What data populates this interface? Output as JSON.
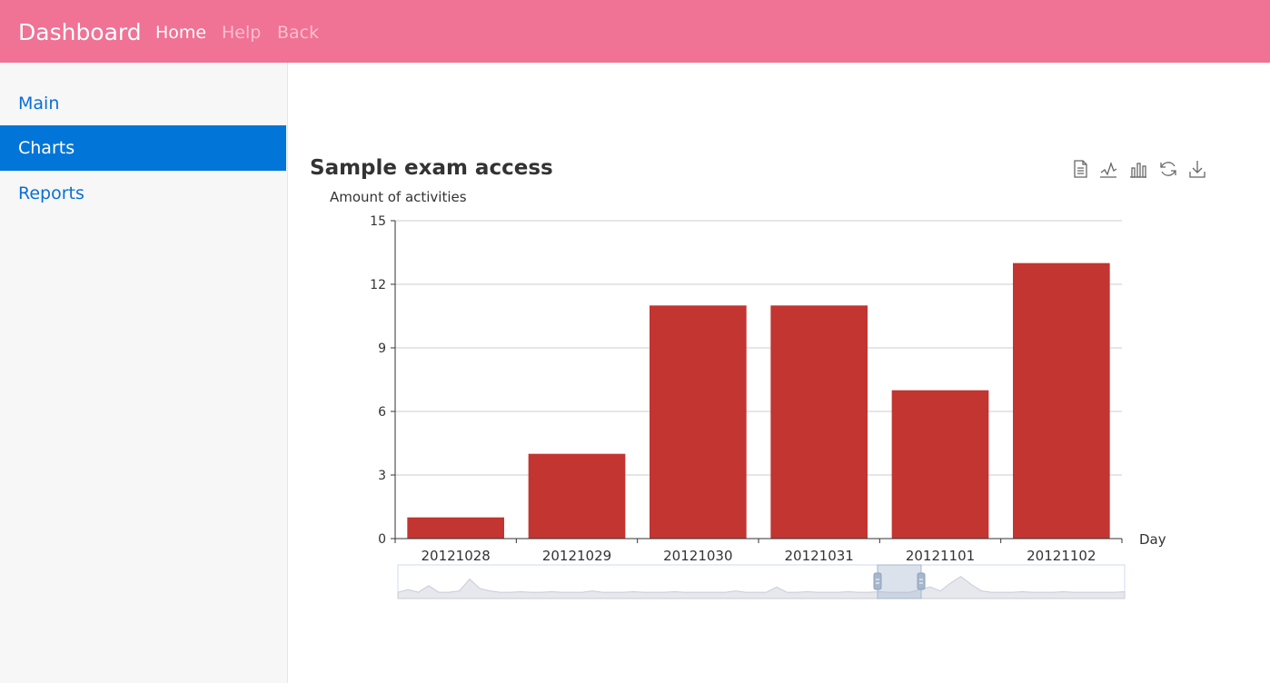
{
  "navbar": {
    "brand": "Dashboard",
    "links": [
      {
        "label": "Home"
      },
      {
        "label": "Help"
      },
      {
        "label": "Back"
      }
    ],
    "color": "#f07295"
  },
  "sidebar": {
    "items": [
      {
        "label": "Main"
      },
      {
        "label": "Charts"
      },
      {
        "label": "Reports"
      }
    ],
    "active_color": "#0275d8"
  },
  "chart": {
    "title": "Sample exam access",
    "toolbox": [
      "data-view-icon",
      "line-chart-icon",
      "bar-chart-icon",
      "restore-icon",
      "download-icon"
    ]
  },
  "chart_data": {
    "type": "bar",
    "title": "Sample exam access",
    "ylabel": "Amount of activities",
    "xlabel": "Day",
    "categories": [
      "20121028",
      "20121029",
      "20121030",
      "20121031",
      "20121101",
      "20121102"
    ],
    "values": [
      1,
      4,
      11,
      11,
      7,
      13
    ],
    "ylim": [
      0,
      15
    ],
    "yticks": [
      0,
      3,
      6,
      9,
      12,
      15
    ],
    "grid": true,
    "bar_color": "#c23531",
    "data_zoom": true,
    "zoom_window_percent": [
      66,
      72
    ]
  }
}
